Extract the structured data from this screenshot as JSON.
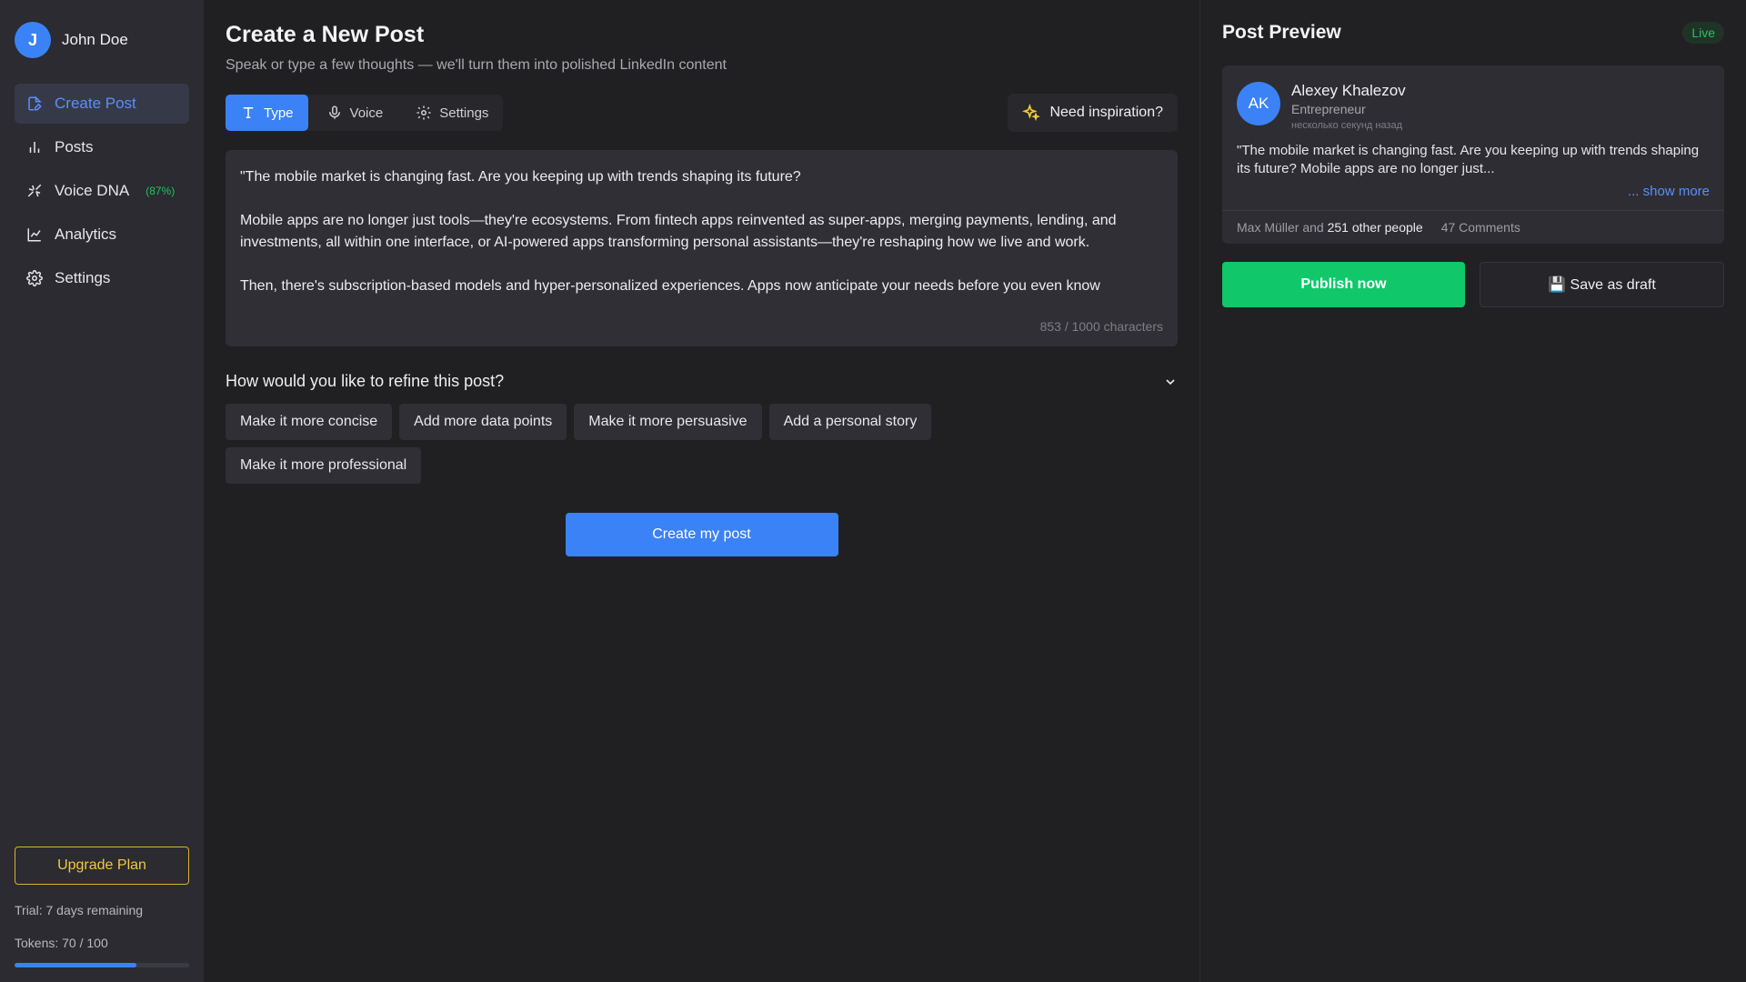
{
  "user": {
    "initial": "J",
    "name": "John Doe"
  },
  "sidebar": {
    "items": [
      {
        "label": "Create Post",
        "icon": "file-edit-icon",
        "active": true
      },
      {
        "label": "Posts",
        "icon": "bar-chart-icon"
      },
      {
        "label": "Voice DNA",
        "icon": "dna-icon",
        "badge": "(87%)"
      },
      {
        "label": "Analytics",
        "icon": "line-chart-icon"
      },
      {
        "label": "Settings",
        "icon": "gear-icon"
      }
    ],
    "upgrade_label": "Upgrade Plan",
    "trial_text": "Trial: 7 days remaining",
    "tokens_text": "Tokens: 70 / 100",
    "tokens_progress": 0.7
  },
  "main": {
    "title": "Create a New Post",
    "subtitle": "Speak or type a few thoughts — we'll turn them into polished LinkedIn content",
    "tabs": [
      {
        "label": "Type",
        "icon": "text-icon",
        "active": true
      },
      {
        "label": "Voice",
        "icon": "microphone-icon"
      },
      {
        "label": "Settings",
        "icon": "gear-icon"
      }
    ],
    "inspiration_label": "Need inspiration?",
    "editor_text": "\"The mobile market is changing fast. Are you keeping up with trends shaping its future?\n\nMobile apps are no longer just tools—they're ecosystems. From fintech apps reinvented as super-apps, merging payments, lending, and investments, all within one interface, or AI-powered apps transforming personal assistants—they're reshaping how we live and work.\n\nThen, there's subscription-based models and hyper-personalized experiences. Apps now anticipate your needs before you even know",
    "char_count": "853 / 1000 characters",
    "refine_title": "How would you like to refine this post?",
    "refine_options": [
      "Make it more concise",
      "Add more data points",
      "Make it more persuasive",
      "Add a personal story",
      "Make it more professional"
    ],
    "create_label": "Create my post"
  },
  "preview": {
    "title": "Post Preview",
    "badge": "Live",
    "author_initials": "AK",
    "author_name": "Alexey Khalezov",
    "author_role": "Entrepreneur",
    "author_time": "несколько секунд назад",
    "excerpt": "\"The mobile market is changing fast. Are you keeping up with trends shaping its future? Mobile apps are no longer just...",
    "show_more": "... show more",
    "reactions_prefix": "Max Müller and ",
    "reactions_bold": "251 other people",
    "comments": "47 Comments",
    "publish_label": "Publish now",
    "draft_label": "💾 Save as draft"
  },
  "colors": {
    "accent": "#3b82f6",
    "success": "#10c86a",
    "warning": "#f3c93a",
    "background": "#202022",
    "sidebar": "#2b2b31"
  }
}
